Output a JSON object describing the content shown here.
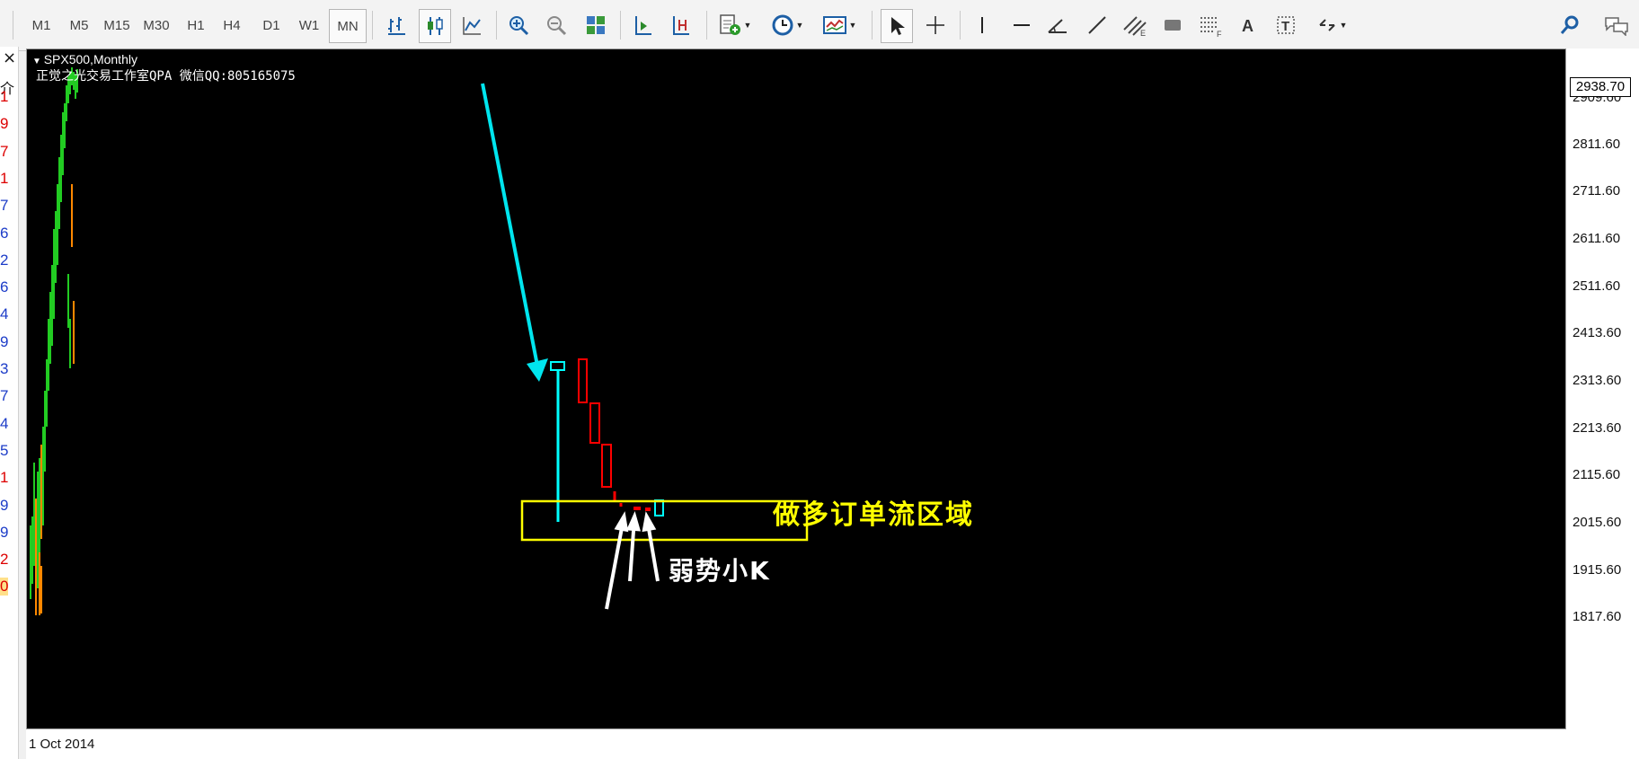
{
  "toolbar": {
    "timeframes": [
      "M1",
      "M5",
      "M15",
      "M30",
      "H1",
      "H4",
      "D1",
      "W1",
      "MN"
    ],
    "active_timeframe": "MN"
  },
  "left_panel": {
    "close_glyph": "×",
    "header_glyph": "介",
    "values": [
      {
        "text": "1",
        "color": "red"
      },
      {
        "text": "9",
        "color": "red"
      },
      {
        "text": "7",
        "color": "red"
      },
      {
        "text": "1",
        "color": "red"
      },
      {
        "text": "7",
        "color": "blue"
      },
      {
        "text": "6",
        "color": "blue"
      },
      {
        "text": "2",
        "color": "blue"
      },
      {
        "text": "6",
        "color": "blue"
      },
      {
        "text": "4",
        "color": "blue"
      },
      {
        "text": "9",
        "color": "blue"
      },
      {
        "text": "3",
        "color": "blue"
      },
      {
        "text": "7",
        "color": "blue"
      },
      {
        "text": "4",
        "color": "blue"
      },
      {
        "text": "5",
        "color": "blue"
      },
      {
        "text": "1",
        "color": "red"
      },
      {
        "text": "9",
        "color": "blue"
      },
      {
        "text": "9",
        "color": "blue"
      },
      {
        "text": "2",
        "color": "red"
      },
      {
        "text": "0",
        "color": "highlight"
      }
    ]
  },
  "chart": {
    "symbol_label": "SPX500,Monthly",
    "subtitle": "正觉之光交易工作室QPA 微信QQ:805165075",
    "current_price": "2938.70",
    "price_ticks": [
      "2909.60",
      "2811.60",
      "2711.60",
      "2611.60",
      "2511.60",
      "2413.60",
      "2313.60",
      "2213.60",
      "2115.60",
      "2015.60",
      "1915.60",
      "1817.60"
    ],
    "x_label": "1 Oct 2014",
    "annotations": {
      "zone_label": "做多订单流区域",
      "weak_candles_label": "弱势小K"
    },
    "colors": {
      "background": "#000000",
      "bull_candle": "#00ffff",
      "bear_candle": "#ff0000",
      "zone": "#ffff00",
      "arrow": "#00e5ee",
      "early_bull": "#22cc22",
      "early_bear": "#ff8800"
    }
  }
}
